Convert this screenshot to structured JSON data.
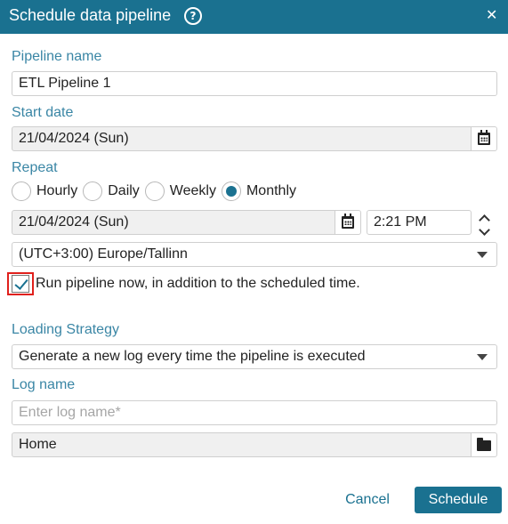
{
  "dialog": {
    "title": "Schedule data pipeline",
    "help_icon": "question-circle-icon",
    "close_icon": "close-icon",
    "close_glyph": "✕"
  },
  "pipeline_name": {
    "label": "Pipeline name",
    "value": "ETL Pipeline 1"
  },
  "start_date": {
    "label": "Start date",
    "value": "21/04/2024 (Sun)",
    "icon": "calendar-icon"
  },
  "repeat": {
    "label": "Repeat",
    "options": [
      {
        "label": "Hourly",
        "checked": false
      },
      {
        "label": "Daily",
        "checked": false
      },
      {
        "label": "Weekly",
        "checked": false
      },
      {
        "label": "Monthly",
        "checked": true
      }
    ],
    "date_value": "21/04/2024 (Sun)",
    "time_value": "2:21 PM",
    "timezone_value": "(UTC+3:00) Europe/Tallinn"
  },
  "run_now": {
    "checked": true,
    "label": "Run pipeline now, in addition to the scheduled time."
  },
  "loading_strategy": {
    "label": "Loading Strategy",
    "value": "Generate a new log every time the pipeline is executed"
  },
  "log_name": {
    "label": "Log name",
    "placeholder": "Enter log name*",
    "location_value": "Home",
    "location_icon": "folder-icon"
  },
  "footer": {
    "cancel_label": "Cancel",
    "schedule_label": "Schedule"
  },
  "colors": {
    "primary": "#1a7190",
    "label": "#3a86a5",
    "highlight_border": "#e0201c"
  }
}
